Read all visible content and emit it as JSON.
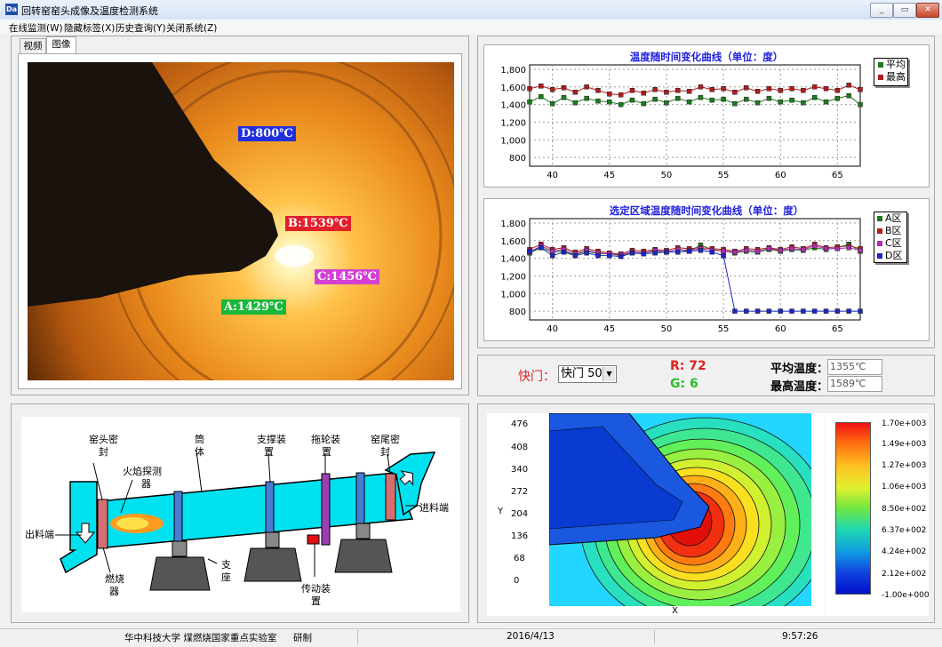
{
  "app": {
    "title": "回转窑窑头成像及温度检测系统",
    "icon_text": "Da",
    "min": "_",
    "max": "▭",
    "close": "✕"
  },
  "menu": [
    "在线监测(W)",
    "隐藏标签(X)",
    "历史查询(Y)",
    "关闭系统(Z)"
  ],
  "tabs": [
    "视频",
    "图像"
  ],
  "image_labels": [
    {
      "id": "D",
      "text": "D:800℃",
      "color": "#1f2fe0"
    },
    {
      "id": "B",
      "text": "B:1539℃",
      "color": "#e0202a"
    },
    {
      "id": "C",
      "text": "C:1456℃",
      "color": "#d43fd4"
    },
    {
      "id": "A",
      "text": "A:1429℃",
      "color": "#18b83a"
    }
  ],
  "chart_data": [
    {
      "type": "line",
      "title": "温度随时间变化曲线（单位：度）",
      "x": [
        38,
        39,
        40,
        41,
        42,
        43,
        44,
        45,
        46,
        47,
        48,
        49,
        50,
        51,
        52,
        53,
        54,
        55,
        56,
        57,
        58,
        59,
        60,
        61,
        62,
        63,
        64,
        65,
        66,
        67
      ],
      "xticks": [
        40,
        45,
        50,
        55,
        60,
        65
      ],
      "yticks": [
        800,
        1000,
        1200,
        1400,
        1600,
        1800
      ],
      "ytick_labels": [
        "800",
        "1,000",
        "1,200",
        "1,400",
        "1,600",
        "1,800"
      ],
      "xlim": [
        38,
        67
      ],
      "ylim": [
        700,
        1850
      ],
      "grid": true,
      "legend": "top-right",
      "series": [
        {
          "name": "平均",
          "color": "#1e7a1e",
          "values": [
            1430,
            1490,
            1410,
            1480,
            1420,
            1470,
            1440,
            1430,
            1400,
            1450,
            1410,
            1460,
            1420,
            1470,
            1430,
            1480,
            1450,
            1460,
            1410,
            1460,
            1420,
            1470,
            1430,
            1450,
            1420,
            1480,
            1430,
            1470,
            1500,
            1400
          ]
        },
        {
          "name": "最高",
          "color": "#b01c1c",
          "values": [
            1580,
            1610,
            1570,
            1590,
            1540,
            1600,
            1560,
            1520,
            1510,
            1560,
            1530,
            1570,
            1540,
            1560,
            1550,
            1600,
            1570,
            1580,
            1540,
            1590,
            1550,
            1580,
            1560,
            1580,
            1560,
            1600,
            1580,
            1560,
            1620,
            1570
          ]
        }
      ]
    },
    {
      "type": "line",
      "title": "选定区域温度随时间变化曲线（单位：度）",
      "x": [
        38,
        39,
        40,
        41,
        42,
        43,
        44,
        45,
        46,
        47,
        48,
        49,
        50,
        51,
        52,
        53,
        54,
        55,
        56,
        57,
        58,
        59,
        60,
        61,
        62,
        63,
        64,
        65,
        66,
        67
      ],
      "xticks": [
        40,
        45,
        50,
        55,
        60,
        65
      ],
      "yticks": [
        800,
        1000,
        1200,
        1400,
        1600,
        1800
      ],
      "ytick_labels": [
        "800",
        "1,000",
        "1,200",
        "1,400",
        "1,600",
        "1,800"
      ],
      "xlim": [
        38,
        67
      ],
      "ylim": [
        700,
        1850
      ],
      "grid": true,
      "legend": "top-right",
      "series": [
        {
          "name": "A区",
          "color": "#1e7a1e",
          "values": [
            1460,
            1520,
            1470,
            1480,
            1440,
            1480,
            1450,
            1450,
            1430,
            1470,
            1460,
            1480,
            1470,
            1500,
            1480,
            1550,
            1500,
            1480,
            1460,
            1480,
            1470,
            1500,
            1480,
            1500,
            1490,
            1520,
            1500,
            1520,
            1560,
            1480
          ]
        },
        {
          "name": "B区",
          "color": "#b01c1c",
          "values": [
            1500,
            1560,
            1500,
            1520,
            1470,
            1510,
            1480,
            1460,
            1450,
            1490,
            1480,
            1500,
            1490,
            1520,
            1510,
            1520,
            1510,
            1500,
            1480,
            1510,
            1500,
            1520,
            1500,
            1530,
            1510,
            1560,
            1520,
            1530,
            1540,
            1510
          ]
        },
        {
          "name": "C区",
          "color": "#b02cb0",
          "values": [
            1470,
            1540,
            1480,
            1500,
            1450,
            1490,
            1460,
            1450,
            1440,
            1470,
            1460,
            1490,
            1470,
            1500,
            1490,
            1510,
            1490,
            1480,
            1470,
            1490,
            1480,
            1510,
            1490,
            1510,
            1500,
            1540,
            1510,
            1510,
            1520,
            1490
          ]
        },
        {
          "name": "D区",
          "color": "#1c28c0",
          "values": [
            1480,
            1520,
            1430,
            1470,
            1430,
            1460,
            1430,
            1430,
            1420,
            1460,
            1450,
            1460,
            1470,
            1470,
            1480,
            1490,
            1470,
            1430,
            800,
            800,
            800,
            800,
            800,
            800,
            800,
            800,
            800,
            800,
            800,
            800
          ]
        }
      ]
    },
    {
      "type": "heatmap",
      "xlabel": "X",
      "ylabel": "Y",
      "yticks": [
        "476",
        "408",
        "340",
        "272",
        "204",
        "136",
        "68",
        "0"
      ],
      "colorbar": [
        "1.70e+003",
        "1.49e+003",
        "1.27e+003",
        "1.06e+003",
        "8.50e+002",
        "6.37e+002",
        "4.24e+002",
        "2.12e+002",
        "-1.00e+000"
      ]
    }
  ],
  "controls": {
    "shutter_label": "快门：",
    "shutter_value": "快门 50",
    "r_text": "R: 72",
    "g_text": "G: 6",
    "avg_label": "平均温度：",
    "avg_value": "1355℃",
    "max_label": "最高温度：",
    "max_value": "1589℃"
  },
  "diagram": {
    "kiln_head_seal": [
      "窑头密",
      "封"
    ],
    "flame_detector": [
      "火焰探测",
      "器"
    ],
    "cylinder": [
      "筒",
      "体"
    ],
    "support": [
      "支撑装",
      "置"
    ],
    "roller": [
      "拖轮装",
      "置"
    ],
    "kiln_tail_seal": [
      "窑尾密",
      "封"
    ],
    "feed_in": "进料端",
    "feed_out": "出料端",
    "burner": [
      "燃烧",
      "器"
    ],
    "base": [
      "支",
      "座"
    ],
    "drive": [
      "传动装",
      "置"
    ]
  },
  "statusbar": {
    "org": "华中科技大学 煤燃烧国家重点实验室",
    "made": "研制",
    "date": "2016/4/13",
    "time": "9:57:26"
  }
}
